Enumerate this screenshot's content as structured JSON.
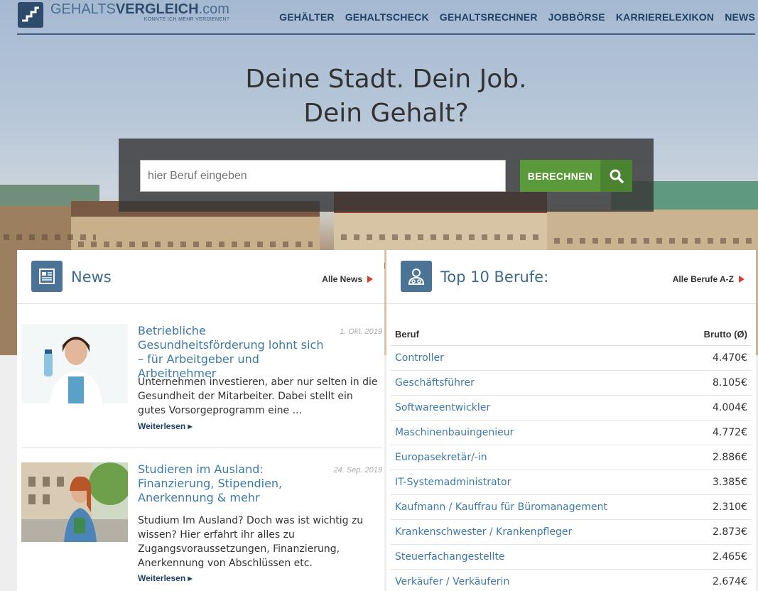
{
  "logo": {
    "brand_light": "GEHALTS",
    "brand_bold": "VERGLEICH",
    "brand_tld": ".com",
    "tagline": "KÖNNTE ICH MEHR VERDIENEN?"
  },
  "nav": [
    "GEHÄLTER",
    "GEHALTSCHECK",
    "GEHALTSRECHNER",
    "JOBBÖRSE",
    "KARRIERELEXIKON",
    "NEWS"
  ],
  "hero": {
    "line1": "Deine Stadt. Dein Job.",
    "line2": "Dein Gehalt?"
  },
  "search": {
    "placeholder": "hier Beruf eingeben",
    "button_label": "BERECHNEN"
  },
  "news": {
    "title": "News",
    "all_link": "Alle News",
    "items": [
      {
        "title": "Betriebliche Gesundheitsförderung lohnt sich – für Arbeitgeber und Arbeitnehmer",
        "date": "1. Okt. 2019",
        "text": "Unternehmen investieren, aber nur selten in die Gesundheit der Mitarbeiter. Dabei stellt ein gutes Vorsorgeprogramm eine ...",
        "more": "Weiterlesen ▸"
      },
      {
        "title": "Studieren im Ausland: Finanzierung, Stipendien, Anerkennung & mehr",
        "date": "24. Sep. 2019",
        "text": "Studium Im Ausland? Doch was ist wichtig zu wissen? Hier erfahrt ihr alles zu Zugangsvoraussetzungen, Finanzierung, Anerkennung von Abschlüssen etc.",
        "more": "Weiterlesen ▸"
      }
    ]
  },
  "top_jobs": {
    "title": "Top 10 Berufe:",
    "all_link": "Alle Berufe A-Z",
    "col_job": "Beruf",
    "col_value": "Brutto (Ø)",
    "rows": [
      {
        "job": "Controller",
        "value": "4.470€"
      },
      {
        "job": "Geschäftsführer",
        "value": "8.105€"
      },
      {
        "job": "Softwareentwickler",
        "value": "4.004€"
      },
      {
        "job": "Maschinenbauingenieur",
        "value": "4.772€"
      },
      {
        "job": "Europasekretär/-in",
        "value": "2.886€"
      },
      {
        "job": "IT-Systemadministrator",
        "value": "3.385€"
      },
      {
        "job": "Kaufmann / Kauffrau für Büromanagement",
        "value": "2.310€"
      },
      {
        "job": "Krankenschwester / Krankenpfleger",
        "value": "2.873€"
      },
      {
        "job": "Steuerfachangestellte",
        "value": "2.465€"
      },
      {
        "job": "Verkäufer / Verkäuferin",
        "value": "2.674€"
      }
    ]
  }
}
